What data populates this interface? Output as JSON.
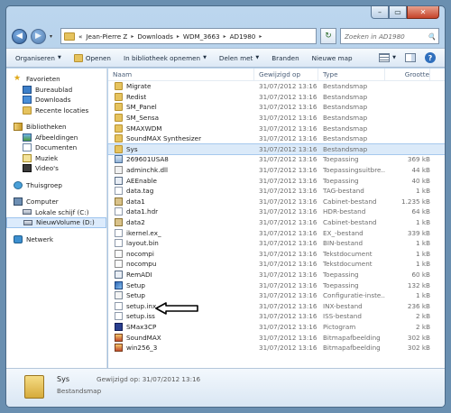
{
  "window": {
    "minimize": "–",
    "maximize": "▭",
    "close": "✕"
  },
  "address": {
    "back": "◀",
    "forward": "▶",
    "dropdown": "▾",
    "crumbs": [
      "«",
      "Jean-Pierre Z",
      "Downloads",
      "WDM_3663",
      "AD1980"
    ],
    "refresh": "↻",
    "search_placeholder": "Zoeken in AD1980",
    "search_icon": "🔍"
  },
  "toolbar": {
    "organize": "Organiseren",
    "open": "Openen",
    "library": "In bibliotheek opnemen",
    "share": "Delen met",
    "burn": "Branden",
    "new_folder": "Nieuwe map",
    "help": "?"
  },
  "nav": {
    "favorites": "Favorieten",
    "desktop": "Bureaublad",
    "downloads": "Downloads",
    "recent": "Recente locaties",
    "libraries": "Bibliotheken",
    "pictures": "Afbeeldingen",
    "documents": "Documenten",
    "music": "Muziek",
    "videos": "Video's",
    "homegroup": "Thuisgroep",
    "computer": "Computer",
    "drive_c": "Lokale schijf (C:)",
    "drive_d": "NieuwVolume (D:)",
    "network": "Netwerk"
  },
  "columns": {
    "name": "Naam",
    "date": "Gewijzigd op",
    "type": "Type",
    "size": "Grootte"
  },
  "files": [
    {
      "name": "Migrate",
      "date": "31/07/2012 13:16",
      "type": "Bestandsmap",
      "size": "",
      "icon": "folder"
    },
    {
      "name": "Redist",
      "date": "31/07/2012 13:16",
      "type": "Bestandsmap",
      "size": "",
      "icon": "folder"
    },
    {
      "name": "SM_Panel",
      "date": "31/07/2012 13:16",
      "type": "Bestandsmap",
      "size": "",
      "icon": "folder"
    },
    {
      "name": "SM_Sensa",
      "date": "31/07/2012 13:16",
      "type": "Bestandsmap",
      "size": "",
      "icon": "folder"
    },
    {
      "name": "SMAXWDM",
      "date": "31/07/2012 13:16",
      "type": "Bestandsmap",
      "size": "",
      "icon": "folder"
    },
    {
      "name": "SoundMAX Synthesizer",
      "date": "31/07/2012 13:16",
      "type": "Bestandsmap",
      "size": "",
      "icon": "folder"
    },
    {
      "name": "Sys",
      "date": "31/07/2012 13:16",
      "type": "Bestandsmap",
      "size": "",
      "icon": "folder"
    },
    {
      "name": "269601USA8",
      "date": "31/07/2012 13:16",
      "type": "Toepassing",
      "size": "369 kB",
      "icon": "app"
    },
    {
      "name": "adminchk.dll",
      "date": "31/07/2012 13:16",
      "type": "Toepassingsuitbre...",
      "size": "44 kB",
      "icon": "dll"
    },
    {
      "name": "AEEnable",
      "date": "31/07/2012 13:16",
      "type": "Toepassing",
      "size": "40 kB",
      "icon": "exe"
    },
    {
      "name": "data.tag",
      "date": "31/07/2012 13:16",
      "type": "TAG-bestand",
      "size": "1 kB",
      "icon": "txt"
    },
    {
      "name": "data1",
      "date": "31/07/2012 13:16",
      "type": "Cabinet-bestand",
      "size": "1.235 kB",
      "icon": "cab"
    },
    {
      "name": "data1.hdr",
      "date": "31/07/2012 13:16",
      "type": "HDR-bestand",
      "size": "64 kB",
      "icon": "txt"
    },
    {
      "name": "data2",
      "date": "31/07/2012 13:16",
      "type": "Cabinet-bestand",
      "size": "1 kB",
      "icon": "cab"
    },
    {
      "name": "ikernel.ex_",
      "date": "31/07/2012 13:16",
      "type": "EX_-bestand",
      "size": "339 kB",
      "icon": "txt"
    },
    {
      "name": "layout.bin",
      "date": "31/07/2012 13:16",
      "type": "BIN-bestand",
      "size": "1 kB",
      "icon": "txt"
    },
    {
      "name": "nocompi",
      "date": "31/07/2012 13:16",
      "type": "Tekstdocument",
      "size": "1 kB",
      "icon": "doc"
    },
    {
      "name": "nocompu",
      "date": "31/07/2012 13:16",
      "type": "Tekstdocument",
      "size": "1 kB",
      "icon": "doc"
    },
    {
      "name": "RemADI",
      "date": "31/07/2012 13:16",
      "type": "Toepassing",
      "size": "60 kB",
      "icon": "exe"
    },
    {
      "name": "Setup",
      "date": "31/07/2012 13:16",
      "type": "Toepassing",
      "size": "132 kB",
      "icon": "setup"
    },
    {
      "name": "Setup",
      "date": "31/07/2012 13:16",
      "type": "Configuratie-inste...",
      "size": "1 kB",
      "icon": "ini"
    },
    {
      "name": "setup.inx",
      "date": "31/07/2012 13:16",
      "type": "INX-bestand",
      "size": "236 kB",
      "icon": "txt"
    },
    {
      "name": "setup.iss",
      "date": "31/07/2012 13:16",
      "type": "ISS-bestand",
      "size": "2 kB",
      "icon": "txt"
    },
    {
      "name": "SMax3CP",
      "date": "31/07/2012 13:16",
      "type": "Pictogram",
      "size": "2 kB",
      "icon": "ico"
    },
    {
      "name": "SoundMAX",
      "date": "31/07/2012 13:16",
      "type": "Bitmapafbeelding",
      "size": "302 kB",
      "icon": "bmp"
    },
    {
      "name": "win256_3",
      "date": "31/07/2012 13:16",
      "type": "Bitmapafbeelding",
      "size": "302 kB",
      "icon": "bmp"
    }
  ],
  "details": {
    "name": "Sys",
    "meta": "Gewijzigd op: 31/07/2012 13:16",
    "type": "Bestandsmap"
  }
}
